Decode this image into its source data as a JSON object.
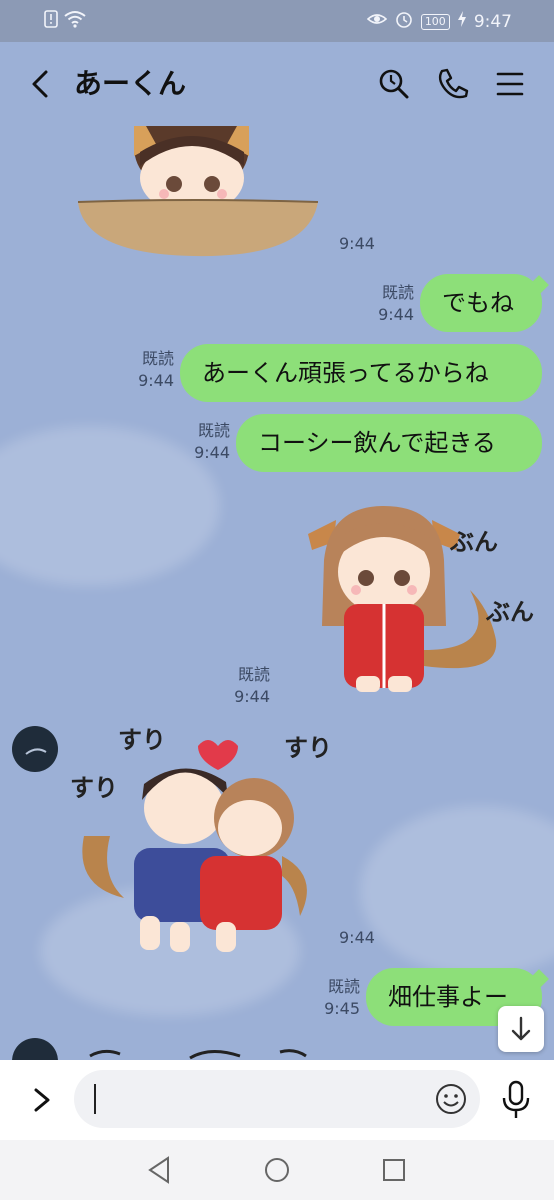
{
  "status_bar": {
    "time": "9:47",
    "battery": "100",
    "icons": [
      "sim-alert-icon",
      "wifi-icon",
      "eye-comfort-icon",
      "alarm-icon",
      "battery-icon",
      "charging-icon"
    ]
  },
  "header": {
    "title": "あーくん",
    "icons": [
      "back-icon",
      "search-icon",
      "call-icon",
      "menu-icon"
    ]
  },
  "messages": [
    {
      "type": "sticker",
      "side": "left",
      "time": "9:44"
    },
    {
      "type": "text",
      "side": "right",
      "text": "でもね",
      "read": "既読",
      "time": "9:44"
    },
    {
      "type": "text",
      "side": "right",
      "text": "あーくん頑張ってるからね",
      "read": "既読",
      "time": "9:44"
    },
    {
      "type": "text",
      "side": "right",
      "text": "コーシー飲んで起きる",
      "read": "既読",
      "time": "9:44"
    },
    {
      "type": "sticker",
      "side": "right",
      "read": "既読",
      "time": "9:44",
      "sticker_text": [
        "ぶん",
        "ぶん"
      ]
    },
    {
      "type": "sticker",
      "side": "left",
      "time": "9:44",
      "sticker_text": [
        "すり",
        "すり",
        "すり"
      ]
    },
    {
      "type": "text",
      "side": "right",
      "text": "畑仕事よー",
      "read": "既読",
      "time": "9:45"
    }
  ],
  "input": {
    "placeholder": ""
  },
  "colors": {
    "background": "#9cb0d6",
    "bubble": "#8ddf79",
    "status_bar": "#8c9ab5"
  }
}
